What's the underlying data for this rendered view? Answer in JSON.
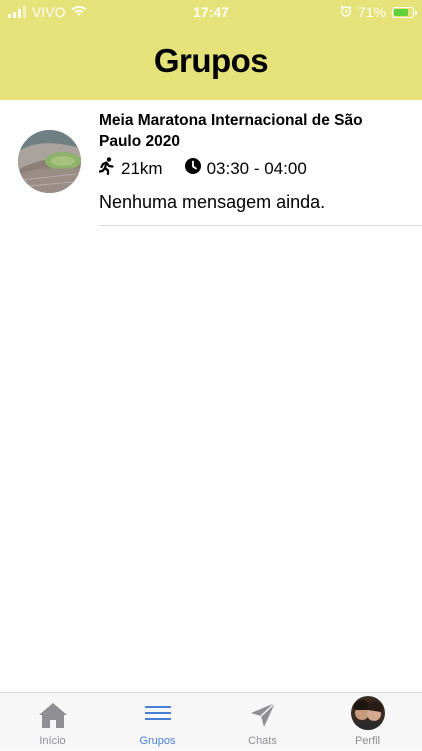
{
  "status_bar": {
    "carrier": "VIVO",
    "time": "17:47",
    "battery": "71%"
  },
  "header": {
    "title": "Grupos",
    "background": "#e6e27a"
  },
  "groups": [
    {
      "name": "Meia Maratona Internacional de São Paulo 2020",
      "distance": "21km",
      "time_range": "03:30 - 04:00",
      "last_message": "Nenhuma mensagem ainda.",
      "icons": [
        "runner-icon",
        "clock-icon"
      ]
    }
  ],
  "tabs": [
    {
      "label": "Início",
      "icon": "home-icon",
      "active": false
    },
    {
      "label": "Grupos",
      "icon": "menu-icon",
      "active": true
    },
    {
      "label": "Chats",
      "icon": "send-icon",
      "active": false
    },
    {
      "label": "Perfil",
      "icon": "avatar",
      "active": false
    }
  ],
  "colors": {
    "accent": "#4a7fd6",
    "inactive": "#8e8e93"
  }
}
